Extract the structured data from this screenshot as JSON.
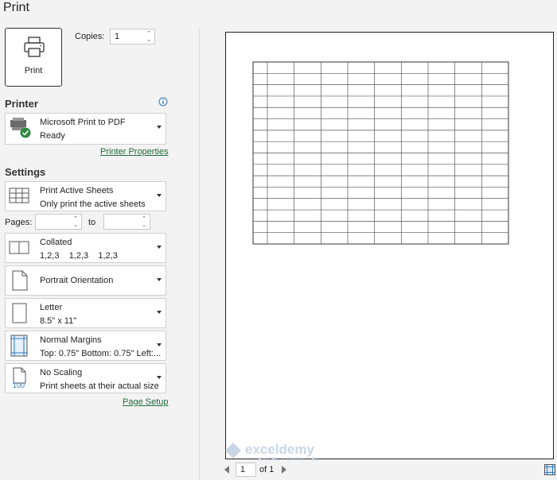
{
  "title": "Print",
  "print_button": {
    "label": "Print"
  },
  "copies": {
    "label": "Copies:",
    "value": "1"
  },
  "printer": {
    "heading": "Printer",
    "name": "Microsoft Print to PDF",
    "status": "Ready",
    "properties_link": "Printer Properties"
  },
  "settings": {
    "heading": "Settings",
    "print_what": {
      "title": "Print Active Sheets",
      "subtitle": "Only print the active sheets"
    },
    "pages": {
      "label": "Pages:",
      "to_label": "to",
      "from_value": "",
      "to_value": ""
    },
    "collation": {
      "title": "Collated",
      "subtitle": "1,2,3    1,2,3    1,2,3"
    },
    "orientation": {
      "title": "Portrait Orientation"
    },
    "paper": {
      "title": "Letter",
      "subtitle": "8.5\" x 11\""
    },
    "margins": {
      "title": "Normal Margins",
      "subtitle": "Top: 0.75\" Bottom: 0.75\" Left:..."
    },
    "scaling": {
      "title": "No Scaling",
      "subtitle": "Print sheets at their actual size",
      "icon_text": "100"
    },
    "page_setup_link": "Page Setup"
  },
  "preview": {
    "grid_rows": 16,
    "grid_cols": 10,
    "page_current": "1",
    "page_total_label": "of 1"
  },
  "watermark": {
    "name": "exceldemy",
    "tagline": "EXCEL · DATA · BI"
  },
  "colors": {
    "link": "#1f6b3a",
    "info": "#2b78c5",
    "check": "#2e8b3e"
  }
}
